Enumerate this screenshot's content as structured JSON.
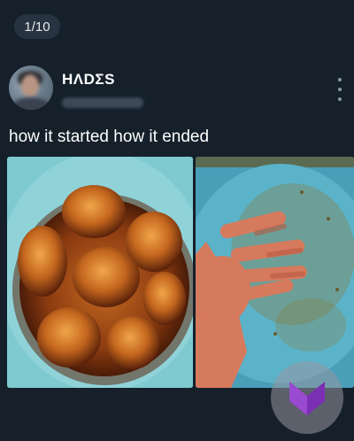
{
  "viewer": {
    "counter": "1/10"
  },
  "post": {
    "author": {
      "display_name": "HΛDΣS"
    },
    "text": "how it started how it ended",
    "media": [
      {
        "name": "tahdig-cake-on-plate"
      },
      {
        "name": "empty-plate-with-oily-hand"
      }
    ]
  },
  "colors": {
    "background": "#15202b",
    "counter_bg": "#273340",
    "text": "#ffffff",
    "muted": "#8b98a5",
    "plate_blue": "#72c4cc",
    "watermark_purple": "#7b2fb3"
  },
  "icons": {
    "more": "vertical-ellipsis-icon",
    "watermark": "purple-chevron-logo"
  }
}
